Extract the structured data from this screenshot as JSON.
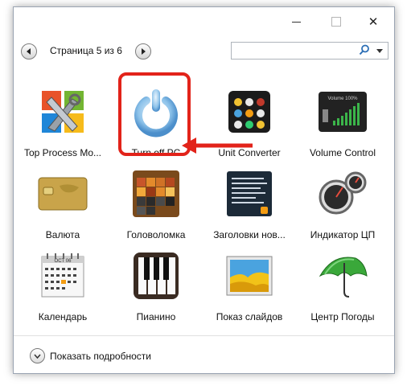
{
  "window": {
    "controls": {
      "minimize": "",
      "maximize": "",
      "close": "✕"
    }
  },
  "nav": {
    "page_label": "Страница 5 из 6"
  },
  "search": {
    "placeholder": ""
  },
  "gadgets": [
    {
      "label": "Top Process Mo...",
      "icon": "tools-icon"
    },
    {
      "label": "Turn off PC",
      "icon": "power-icon"
    },
    {
      "label": "Unit Converter",
      "icon": "unit-converter-icon"
    },
    {
      "label": "Volume Control",
      "icon": "volume-icon"
    },
    {
      "label": "Валюта",
      "icon": "currency-card-icon"
    },
    {
      "label": "Головоломка",
      "icon": "puzzle-icon"
    },
    {
      "label": "Заголовки нов...",
      "icon": "news-headlines-icon"
    },
    {
      "label": "Индикатор ЦП",
      "icon": "cpu-gauge-icon"
    },
    {
      "label": "Календарь",
      "icon": "calendar-icon"
    },
    {
      "label": "Пианино",
      "icon": "piano-icon"
    },
    {
      "label": "Показ слайдов",
      "icon": "slideshow-icon"
    },
    {
      "label": "Центр Погоды",
      "icon": "umbrella-icon"
    }
  ],
  "calendar_icon": {
    "month": "OCT 06"
  },
  "volume_icon": {
    "text": "Volume 100%"
  },
  "details": {
    "label": "Показать подробности"
  },
  "annotation": {
    "highlight_color": "#e2231a"
  }
}
